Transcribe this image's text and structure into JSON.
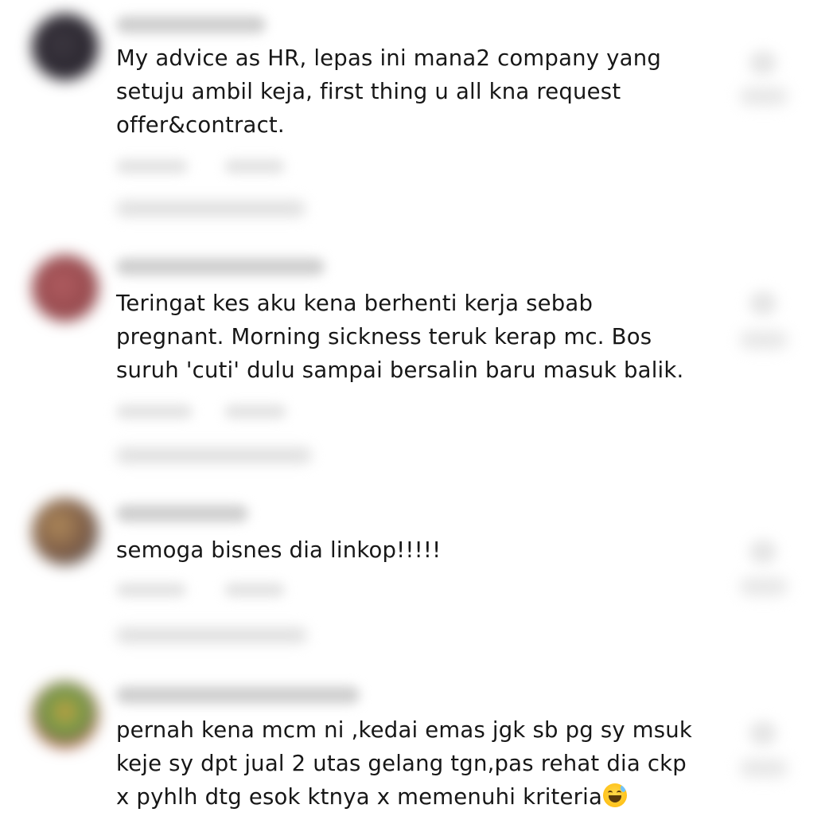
{
  "comments": [
    {
      "text": "My advice as HR, lepas ini mana2 company yang\nsetuju ambil keja, first thing u all kna request\noffer&contract.",
      "avatar_color": "#2e2a33"
    },
    {
      "text": "Teringat kes aku kena berhenti kerja sebab\npregnant. Morning sickness teruk kerap mc. Bos\nsuruh 'cuti' dulu sampai bersalin baru masuk balik.",
      "avatar_color": "#9c5054"
    },
    {
      "text": "semoga bisnes dia linkop!!!!!",
      "avatar_color": "#8a6a4a"
    },
    {
      "text": "pernah kena mcm ni ,kedai emas jgk sb pg sy msuk\nkeje sy dpt jual 2 utas gelang tgn,pas rehat dia ckp\nx pyhlh dtg esok ktnya x memenuhi kriteria",
      "emoji_icon": "grinning-face-with-sweat-icon",
      "avatar_color": "#6a8a4a"
    }
  ]
}
